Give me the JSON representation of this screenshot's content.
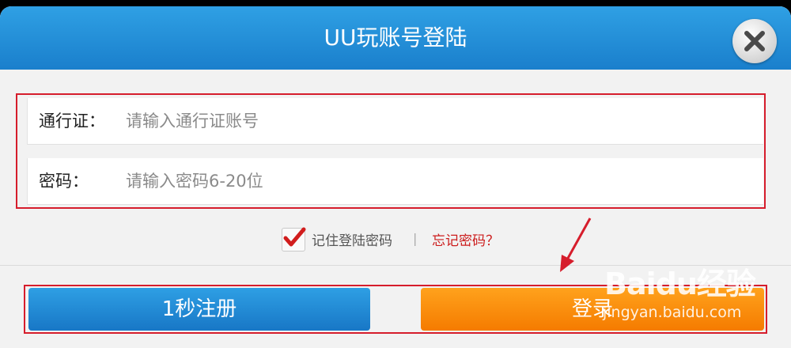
{
  "dialog": {
    "title": "UU玩账号登陆",
    "close_icon": "close-x-icon"
  },
  "form": {
    "account": {
      "label": "通行证：",
      "placeholder": "请输入通行证账号"
    },
    "password": {
      "label": "密码：",
      "placeholder": "请输入密码6-20位"
    }
  },
  "options": {
    "remember_label": "记住登陆密码",
    "remember_checked": true,
    "divider": "|",
    "forgot_link": "忘记密码？"
  },
  "buttons": {
    "register_label": "1秒注册",
    "login_label": "登录"
  },
  "watermark": {
    "logo": "Baidu经验",
    "url": "jingyan.baidu.com"
  },
  "colors": {
    "header_blue": "#1a7fcc",
    "register_blue": "#1877c6",
    "login_orange": "#f57b00",
    "annotation_red": "#d61d2c",
    "forgot_red": "#cc1c1c"
  }
}
